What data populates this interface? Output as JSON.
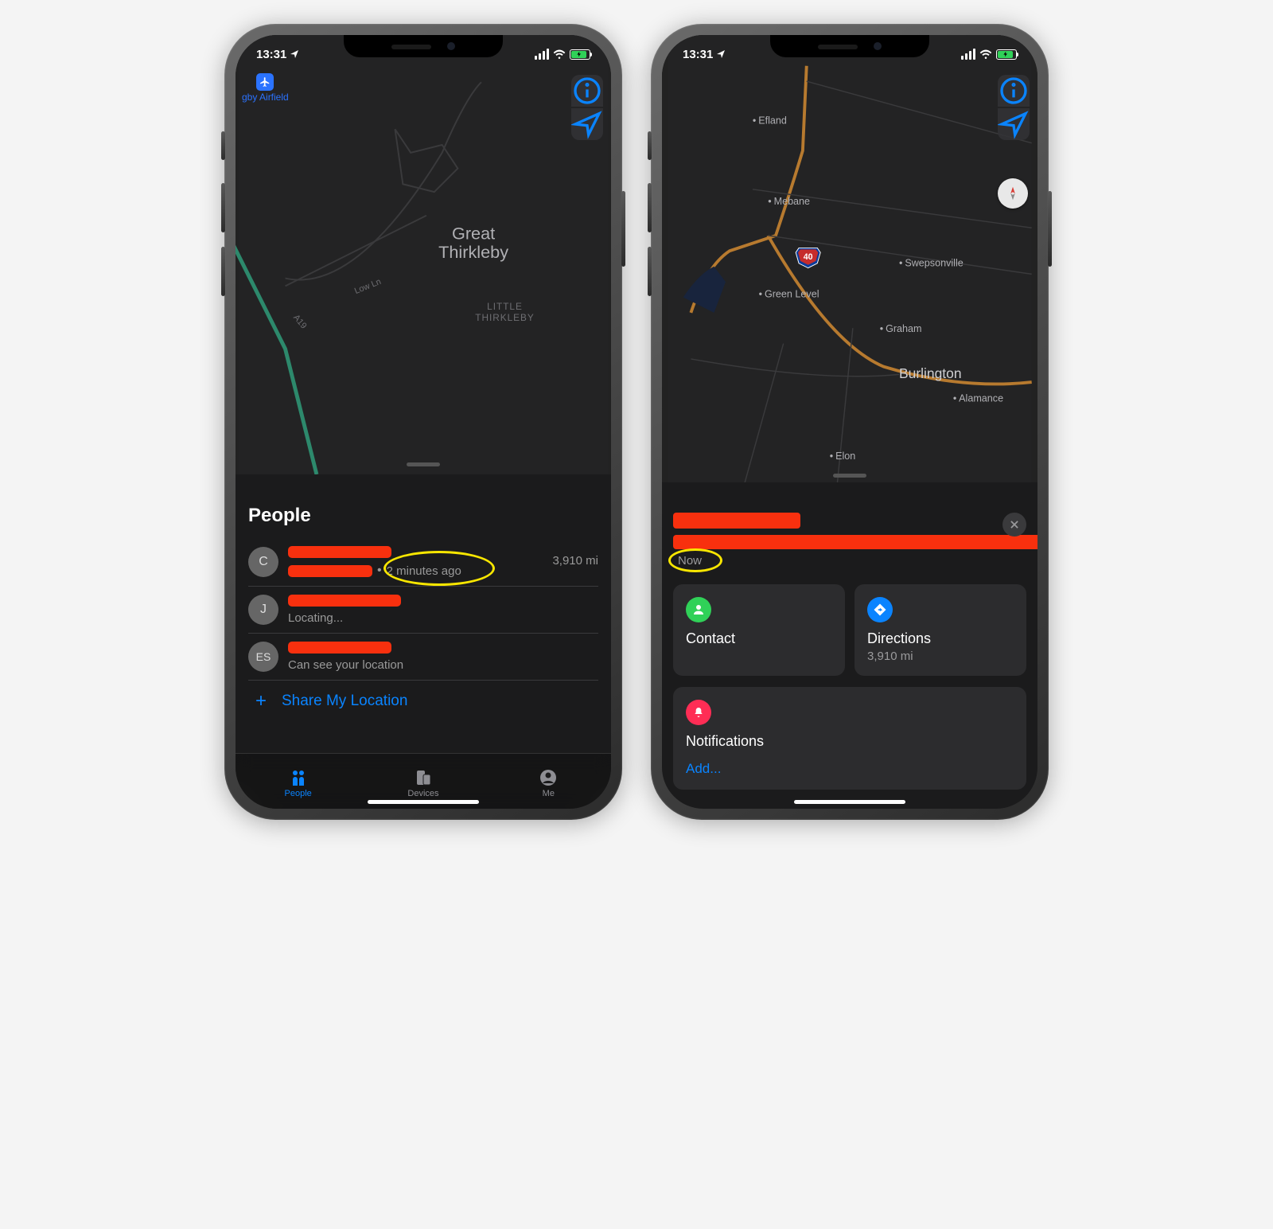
{
  "status": {
    "time": "13:31"
  },
  "left": {
    "airfield_label": "gby Airfield",
    "map_labels": {
      "town": "Great Thirkleby",
      "village": "LITTLE THIRKLEBY",
      "road_a": "A19",
      "road_low": "Low Ln"
    },
    "sheet_title": "People",
    "people": [
      {
        "initial": "C",
        "time": "2 minutes ago",
        "distance": "3,910 mi"
      },
      {
        "initial": "J",
        "status": "Locating..."
      },
      {
        "initial": "ES",
        "status": "Can see your location"
      }
    ],
    "share_label": "Share My Location",
    "tabs": {
      "people": "People",
      "devices": "Devices",
      "me": "Me"
    }
  },
  "right": {
    "map_labels": {
      "efland": "Efland",
      "mebane": "Mebane",
      "swepsonville": "Swepsonville",
      "green": "Green Level",
      "graham": "Graham",
      "burlington": "Burlington",
      "alamance": "Alamance",
      "elon": "Elon",
      "shield": "40"
    },
    "now": "Now",
    "contact": {
      "title": "Contact"
    },
    "directions": {
      "title": "Directions",
      "distance": "3,910 mi"
    },
    "notifications": {
      "title": "Notifications",
      "add": "Add..."
    }
  }
}
